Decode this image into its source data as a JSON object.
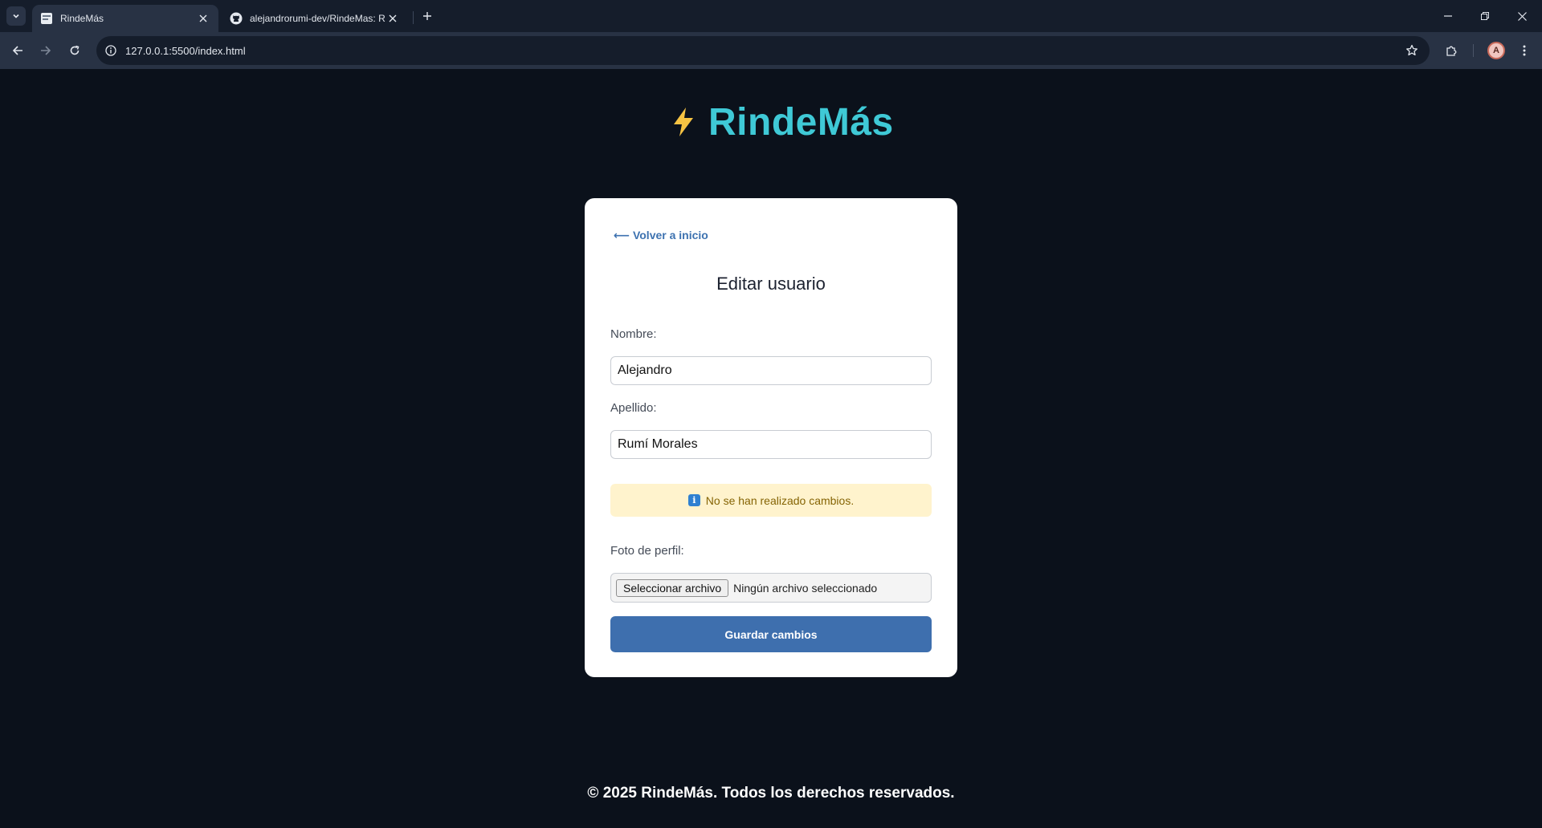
{
  "browser": {
    "tabs": [
      {
        "title": "RindeMás",
        "active": true
      },
      {
        "title": "alejandrorumi-dev/RindeMas: R",
        "active": false
      }
    ],
    "url": "127.0.0.1:5500/index.html",
    "profile_initial": "A"
  },
  "page": {
    "brand": "RindeMás",
    "back_link": "⟵ Volver a inicio",
    "title": "Editar usuario",
    "fields": {
      "nombre_label": "Nombre:",
      "nombre_value": "Alejandro",
      "apellido_label": "Apellido:",
      "apellido_value": "Rumí Morales"
    },
    "notice": {
      "icon": "i",
      "text": "No se han realizado cambios."
    },
    "photo": {
      "label": "Foto de perfil:",
      "button": "Seleccionar archivo",
      "status": "Ningún archivo seleccionado"
    },
    "submit_label": "Guardar cambios",
    "footer": "© 2025 RindeMás. Todos los derechos reservados."
  },
  "colors": {
    "page_bg": "#0b111b",
    "brand": "#3fc9d6",
    "bolt": "#f6c343",
    "link": "#3d72b0",
    "button": "#3e6fae",
    "notice_bg": "#fff3cd",
    "notice_text": "#856404"
  }
}
